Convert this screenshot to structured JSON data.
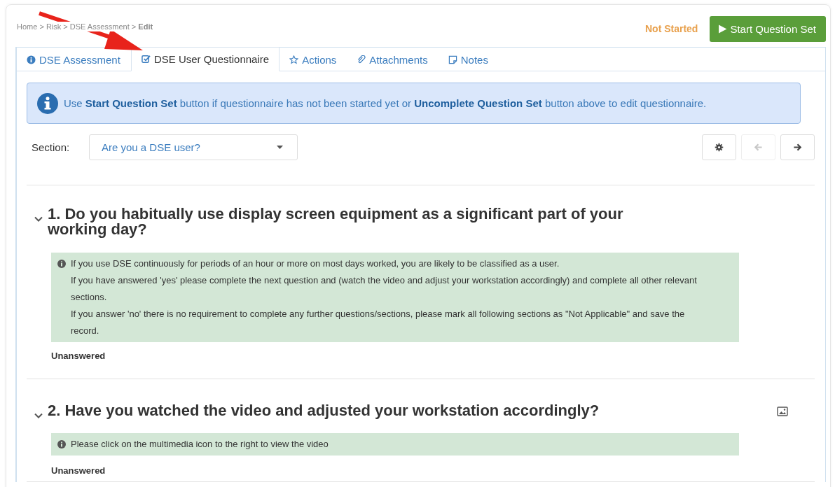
{
  "breadcrumb": "Home > Risk > DSE Assessment > **Edit**",
  "status": "Not Started",
  "start_button": {
    "label": "Start Question Set"
  },
  "tabs": [
    {
      "label": "DSE Assessment",
      "kind": "info",
      "selected": false
    },
    {
      "label": "DSE User Questionnaire",
      "kind": "check",
      "selected": true
    },
    {
      "label": "Actions",
      "kind": "star",
      "selected": false
    },
    {
      "label": "Attachments",
      "kind": "clip",
      "selected": false
    },
    {
      "label": "Notes",
      "kind": "note",
      "selected": false
    }
  ],
  "alert": "Use **Start Question Set** button if questionnaire has not been started yet or **Uncomplete Question Set** button above to edit questionnaire.",
  "section": {
    "label": "Section:",
    "value": "Are you a DSE user?"
  },
  "nav_buttons": [
    {
      "kind": "settings",
      "disabled": false
    },
    {
      "kind": "back",
      "disabled": true
    },
    {
      "kind": "next",
      "disabled": false
    }
  ],
  "questions": [
    {
      "title": "1. Do you habitually use display screen equipment as a significant part of your working day?",
      "expanded": true,
      "media": false,
      "info": [
        "If you use DSE continuously for periods of an hour or more on most days worked, you are likely to be classified as a user.",
        "If you have answered 'yes' please complete the next question and (watch the video and adjust your workstation accordingly) and complete all other relevant sections.",
        "If you answer 'no' there is no requirement to complete any further questions/sections, please mark all following sections as \"Not Applicable\" and save the record."
      ],
      "answer": "Unanswered"
    },
    {
      "title": "2. Have you watched the video and adjusted your workstation accordingly?",
      "expanded": true,
      "media": true,
      "info": [
        "Please click on the multimedia icon to the right to view the video"
      ],
      "answer": "Unanswered"
    }
  ]
}
